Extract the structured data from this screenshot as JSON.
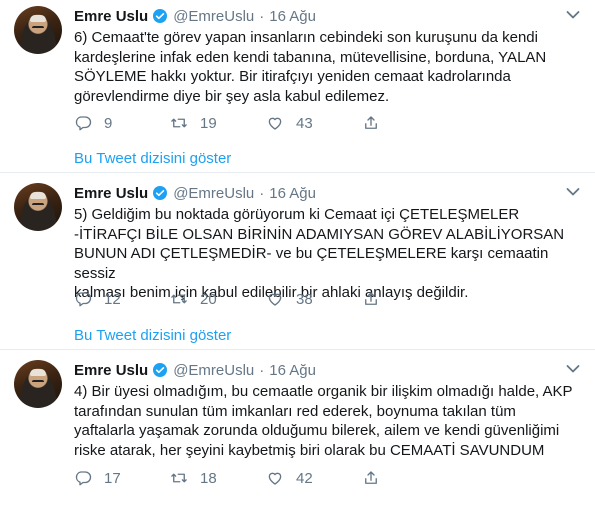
{
  "tweets": [
    {
      "author": "Emre Uslu",
      "handle": "@EmreUslu",
      "separator": "·",
      "date": "16 Ağu",
      "lines": [
        "6) Cemaat'te görev yapan insanların cebindeki son kuruşunu da kendi",
        "kardeşlerine infak eden kendi tabanına, mütevellisine, borduna, YALAN",
        "SÖYLEME hakkı yoktur. Bir itirafçıyı yeniden cemaat kadrolarında",
        "görevlendirme diye bir şey asla kabul edilemez."
      ],
      "replies": "9",
      "retweets": "19",
      "likes": "43",
      "show_thread": "Bu Tweet dizisini göster"
    },
    {
      "author": "Emre Uslu",
      "handle": "@EmreUslu",
      "separator": "·",
      "date": "16 Ağu",
      "lines": [
        "5) Geldiğim bu noktada görüyorum ki Cemaat içi ÇETELEŞMELER",
        "-İTİRAFÇI BİLE OLSAN BİRİNİN ADAMIYSAN GÖREV ALABİLİYORSAN",
        "BUNUN ADI ÇETLEŞMEDİR- ve bu ÇETELEŞMELERE karşı cemaatin sessiz",
        "kalması benim için kabul edilebilir bir ahlaki anlayış değildir."
      ],
      "replies": "12",
      "retweets": "20",
      "likes": "38",
      "show_thread": "Bu Tweet dizisini göster"
    },
    {
      "author": "Emre Uslu",
      "handle": "@EmreUslu",
      "separator": "·",
      "date": "16 Ağu",
      "lines": [
        "4) Bir üyesi olmadığım, bu cemaatle organik bir ilişkim olmadığı halde, AKP",
        "tarafından sunulan tüm imkanları red ederek, boynuma takılan tüm",
        "yaftalarla yaşamak zorunda olduğumu bilerek, ailem ve kendi güvenliğimi",
        "riske atarak, her şeyini kaybetmiş biri olarak bu CEMAATİ SAVUNDUM"
      ],
      "replies": "17",
      "retweets": "18",
      "likes": "42"
    }
  ],
  "colors": {
    "text": "#14171a",
    "muted": "#657786",
    "link": "#1da1f2",
    "verified": "#1da1f2",
    "divider": "#e6ecf0"
  },
  "icons": [
    "verified-badge-icon",
    "chevron-down-icon",
    "reply-icon",
    "retweet-icon",
    "like-icon",
    "share-icon"
  ]
}
